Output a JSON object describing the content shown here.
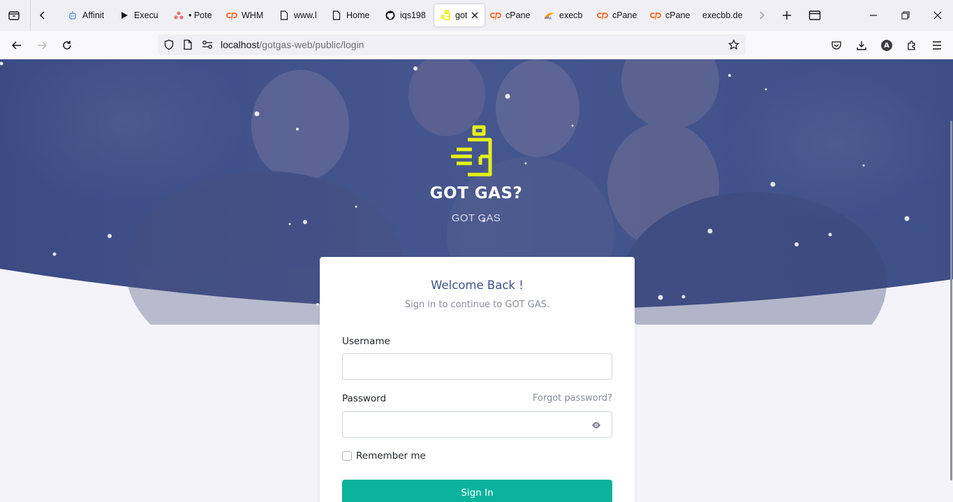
{
  "browser": {
    "tabs": [
      {
        "label": "Affinit",
        "icon": "robot-icon",
        "color": "#4a90e2"
      },
      {
        "label": "Execu",
        "icon": "play-icon",
        "color": "#15141a"
      },
      {
        "label": "• Pote",
        "icon": "asana-dots-icon",
        "color": "#f06a6a"
      },
      {
        "label": "WHM",
        "icon": "cpanel-icon",
        "color": "#ff6c2c"
      },
      {
        "label": "www.l",
        "icon": "page-icon",
        "color": "#15141a"
      },
      {
        "label": "Home",
        "icon": "page-icon",
        "color": "#15141a"
      },
      {
        "label": "iqs198",
        "icon": "github-icon",
        "color": "#15141a"
      },
      {
        "label": "got",
        "icon": "gotgas-icon",
        "color": "#e8f000"
      },
      {
        "label": "cPane",
        "icon": "cpanel-icon",
        "color": "#ff6c2c"
      },
      {
        "label": "execb",
        "icon": "phpmyadmin-icon",
        "color": "#f89c0e"
      },
      {
        "label": "cPane",
        "icon": "cpanel-icon",
        "color": "#ff6c2c"
      },
      {
        "label": "cPane",
        "icon": "cpanel-icon",
        "color": "#ff6c2c"
      },
      {
        "label": "execbb.de",
        "icon": "",
        "color": "#15141a"
      }
    ],
    "active_tab_index": 7,
    "url_host": "localhost",
    "url_path": "/gotgas-web/public/login",
    "profile_initial": "A"
  },
  "brand": {
    "logo_text": "GOT GAS?",
    "subtitle": "GOT GAS",
    "logo_color": "#e6f016"
  },
  "login": {
    "title": "Welcome Back !",
    "subtitle": "Sign in to continue to GOT GAS.",
    "username_label": "Username",
    "username_value": "",
    "password_label": "Password",
    "password_value": "",
    "forgot_label": "Forgot password?",
    "remember_label": "Remember me",
    "remember_checked": false,
    "signin_label": "Sign In"
  },
  "colors": {
    "hero_overlay": "#3d4d8a",
    "page_bg": "#f3f3f9",
    "primary": "#405189",
    "success": "#0ab39c"
  }
}
